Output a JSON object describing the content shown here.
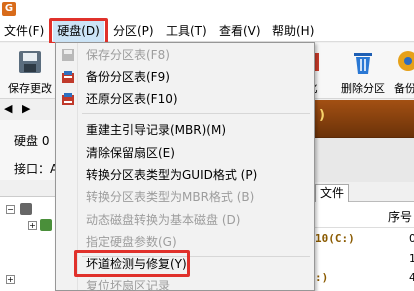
{
  "app": {
    "icon_letter": "G"
  },
  "menubar": {
    "items": [
      {
        "label": "文件(F)"
      },
      {
        "label": "硬盘(D)"
      },
      {
        "label": "分区(P)"
      },
      {
        "label": "工具(T)"
      },
      {
        "label": "查看(V)"
      },
      {
        "label": "帮助(H)"
      }
    ],
    "active_index": 1
  },
  "toolbar": {
    "save_label": "保存更改",
    "delete_partition_label": "删除分区",
    "partial_left_label": "化",
    "partial_right_label": "备份"
  },
  "disk_panel": {
    "disk_label": "硬盘  0",
    "interface_label": "接口：A"
  },
  "tabs": {
    "files_tab": "文件"
  },
  "table": {
    "col_seq": "序号",
    "rows": [
      {
        "part": "10(C:)",
        "seq": "0"
      },
      {
        "part": "",
        "seq": "1"
      },
      {
        "part": ":)",
        "seq": "4"
      }
    ]
  },
  "banner_text": ")",
  "disk_menu": {
    "items": [
      {
        "label": "保存分区表(F8)",
        "enabled": false,
        "icon": "save-partition-table-icon"
      },
      {
        "label": "备份分区表(F9)",
        "enabled": true,
        "icon": "backup-partition-table-icon"
      },
      {
        "label": "还原分区表(F10)",
        "enabled": true,
        "icon": "restore-partition-table-icon"
      },
      {
        "label": "重建主引导记录(MBR)(M)",
        "enabled": true
      },
      {
        "label": "清除保留扇区(E)",
        "enabled": true
      },
      {
        "label": "转换分区表类型为GUID格式 (P)",
        "enabled": true
      },
      {
        "label": "转换分区表类型为MBR格式 (B)",
        "enabled": false
      },
      {
        "label": "动态磁盘转换为基本磁盘 (D)",
        "enabled": false
      },
      {
        "label": "指定硬盘参数(G)",
        "enabled": false
      },
      {
        "label": "坏道检测与修复(Y)",
        "enabled": true
      },
      {
        "label": "复位坏扇区记录",
        "enabled": false
      }
    ]
  },
  "colors": {
    "highlight_border": "#e0312b",
    "banner_brown": "#8a430f",
    "disabled_text": "#9d9d9d"
  }
}
